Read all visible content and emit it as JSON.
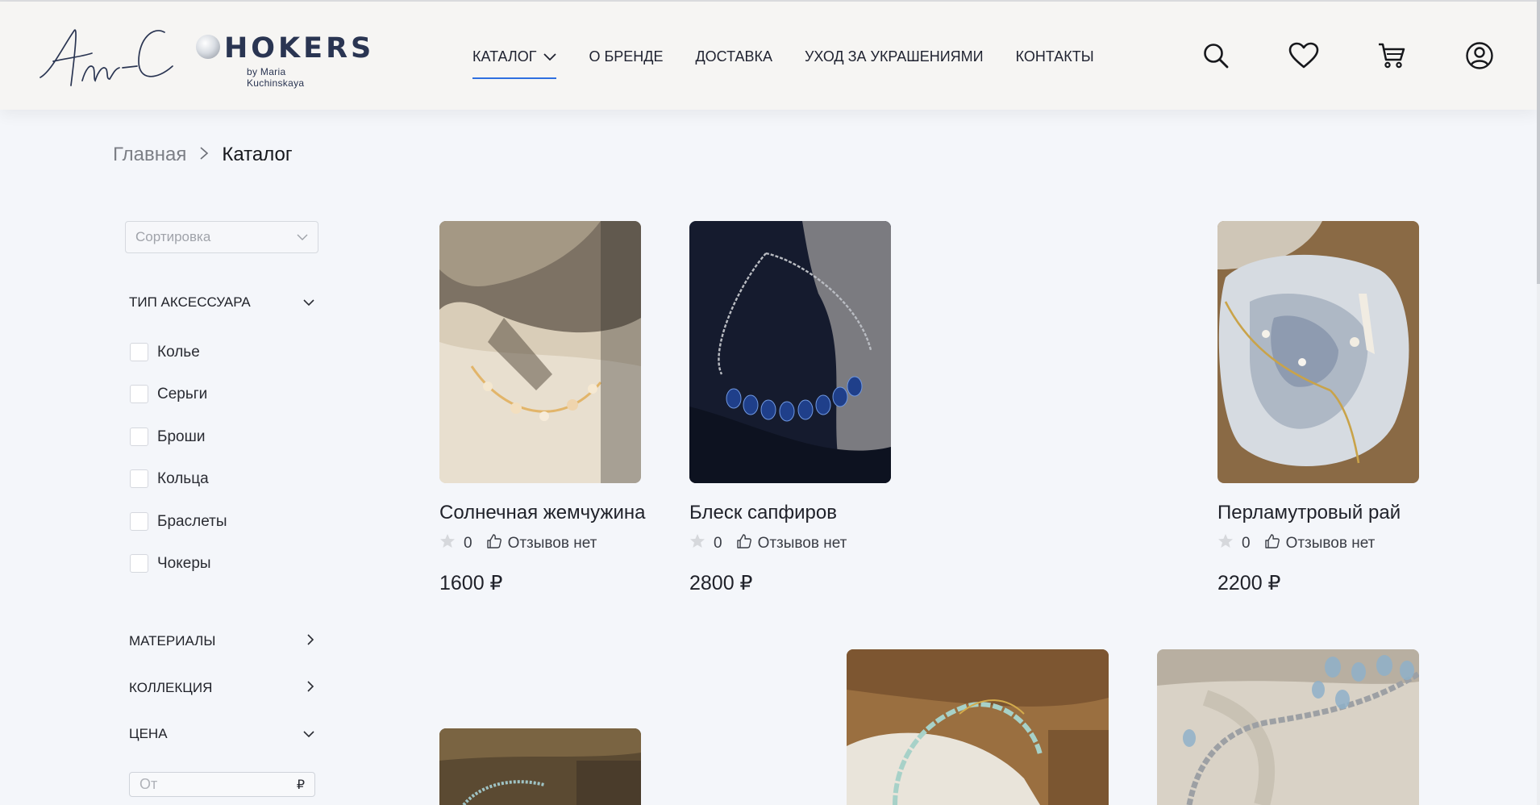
{
  "logo": {
    "script_text": "Am-C",
    "wordmark": "HOKERS",
    "byline": "by Maria Kuchinskaya"
  },
  "nav": {
    "items": [
      {
        "label": "КАТАЛОГ",
        "has_dropdown": true,
        "active": true
      },
      {
        "label": "О БРЕНДЕ"
      },
      {
        "label": "ДОСТАВКА"
      },
      {
        "label": "УХОД ЗА УКРАШЕНИЯМИ"
      },
      {
        "label": "КОНТАКТЫ"
      }
    ],
    "accent_color": "#2f6fe0"
  },
  "header_icons": [
    "search-icon",
    "heart-icon",
    "cart-icon",
    "user-icon"
  ],
  "breadcrumb": {
    "home": "Главная",
    "separator": ">",
    "current": "Каталог"
  },
  "sidebar": {
    "sort_placeholder": "Сортировка",
    "accessory_type": {
      "title": "ТИП АКСЕССУАРА",
      "expanded": true,
      "options": [
        "Колье",
        "Серьги",
        "Броши",
        "Кольца",
        "Браслеты",
        "Чокеры"
      ]
    },
    "materials": {
      "title": "МАТЕРИАЛЫ",
      "expanded": false
    },
    "collection": {
      "title": "КОЛЛЕКЦИЯ",
      "expanded": false
    },
    "price": {
      "title": "ЦЕНА",
      "expanded": true,
      "from_placeholder": "От",
      "currency": "₽"
    }
  },
  "products": [
    {
      "name": "Солнечная жемчужина",
      "rating_count": "0",
      "reviews": "Отзывов нет",
      "price": "1600 ₽"
    },
    {
      "name": "Блеск сапфиров",
      "rating_count": "0",
      "reviews": "Отзывов нет",
      "price": "2800 ₽"
    },
    {
      "name": "Перламутровый рай",
      "rating_count": "0",
      "reviews": "Отзывов нет",
      "price": "2200 ₽"
    }
  ]
}
